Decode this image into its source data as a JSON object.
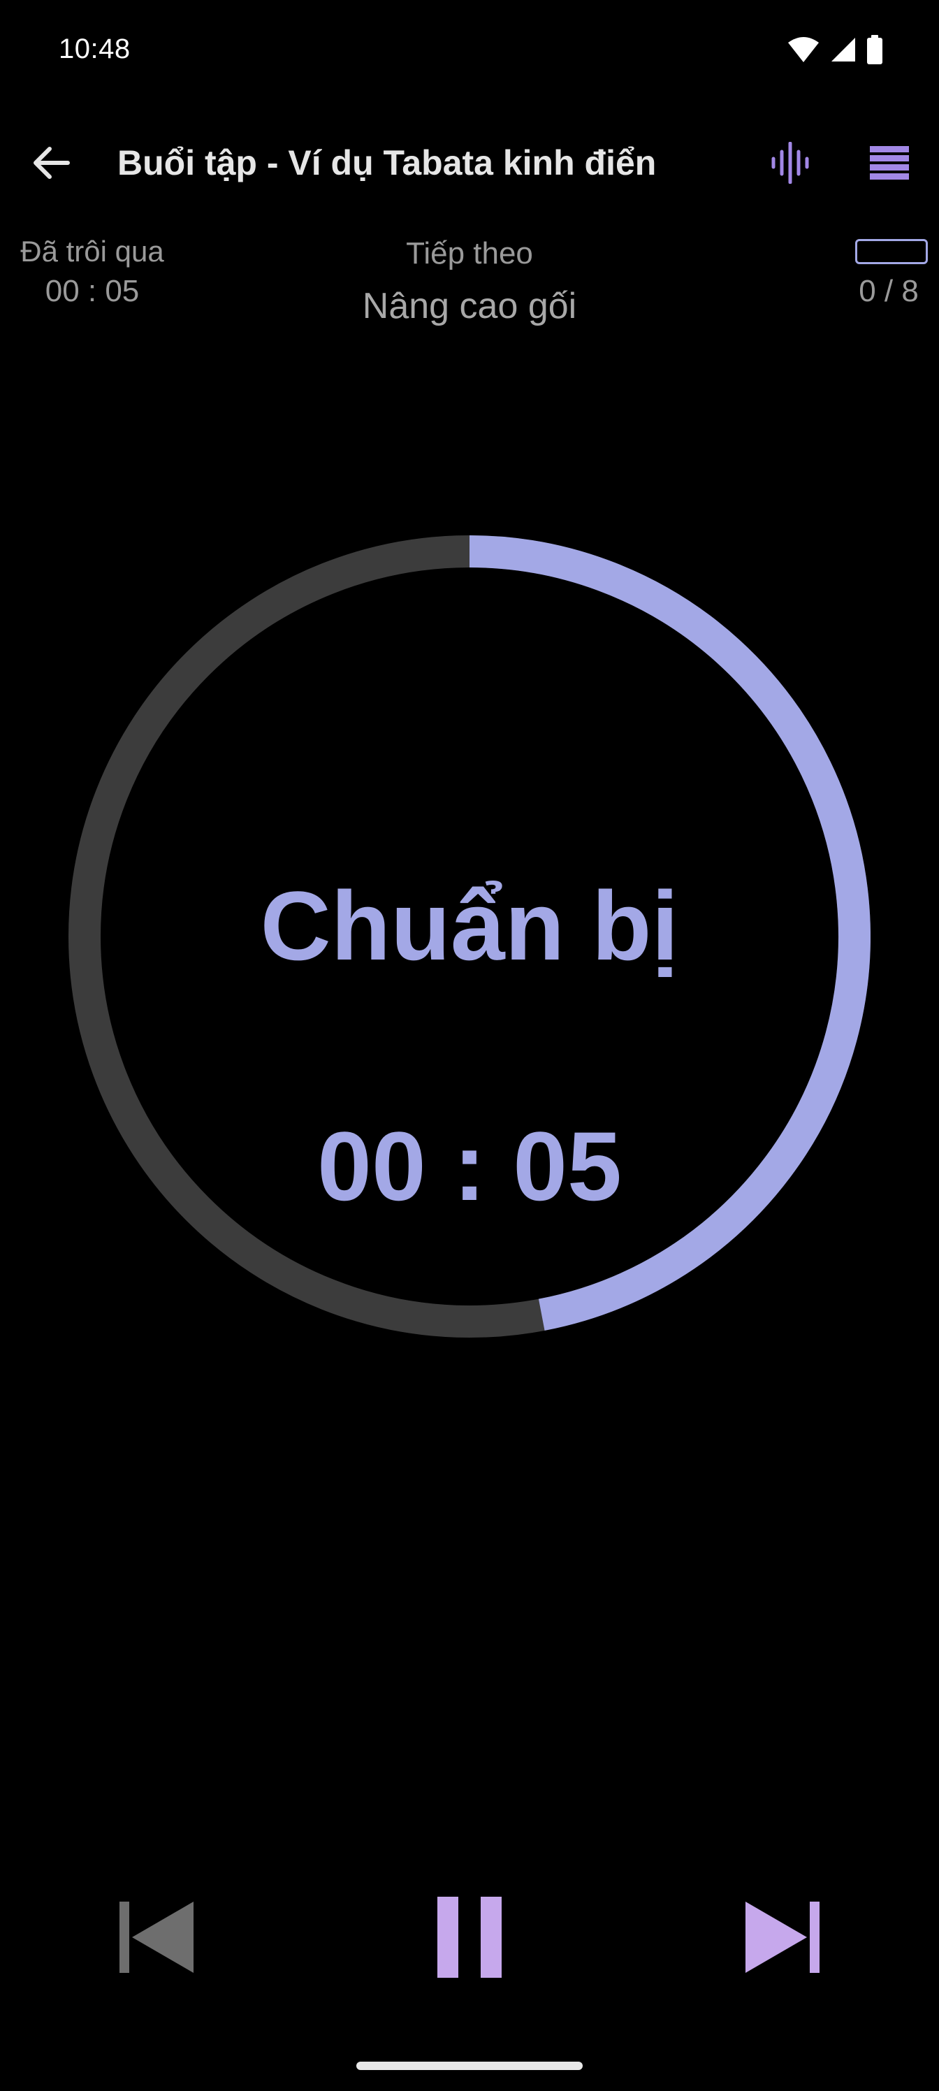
{
  "status_bar": {
    "time": "10:48",
    "icons": [
      "wifi-icon",
      "signal-icon",
      "battery-icon"
    ]
  },
  "app_bar": {
    "title": "Buổi tập - Ví dụ Tabata kinh điển",
    "back_icon": "arrow-left-icon",
    "sound_icon": "sound-wave-icon",
    "menu_icon": "list-icon"
  },
  "info": {
    "elapsed_label": "Đã trôi qua",
    "elapsed_value": "00 : 05",
    "next_label": "Tiếp theo",
    "next_value": "Nâng cao gối",
    "set_count": "0 / 8"
  },
  "timer": {
    "phase": "Chuẩn bị",
    "time": "00 : 05",
    "progress_fraction": 0.47
  },
  "controls": {
    "prev_icon": "skip-previous-icon",
    "pause_icon": "pause-icon",
    "next_icon": "skip-next-icon"
  },
  "colors": {
    "accent": "#a3a8e6",
    "control_accent": "#c6a8ec",
    "track": "#3c3c3c",
    "background": "#000000"
  }
}
